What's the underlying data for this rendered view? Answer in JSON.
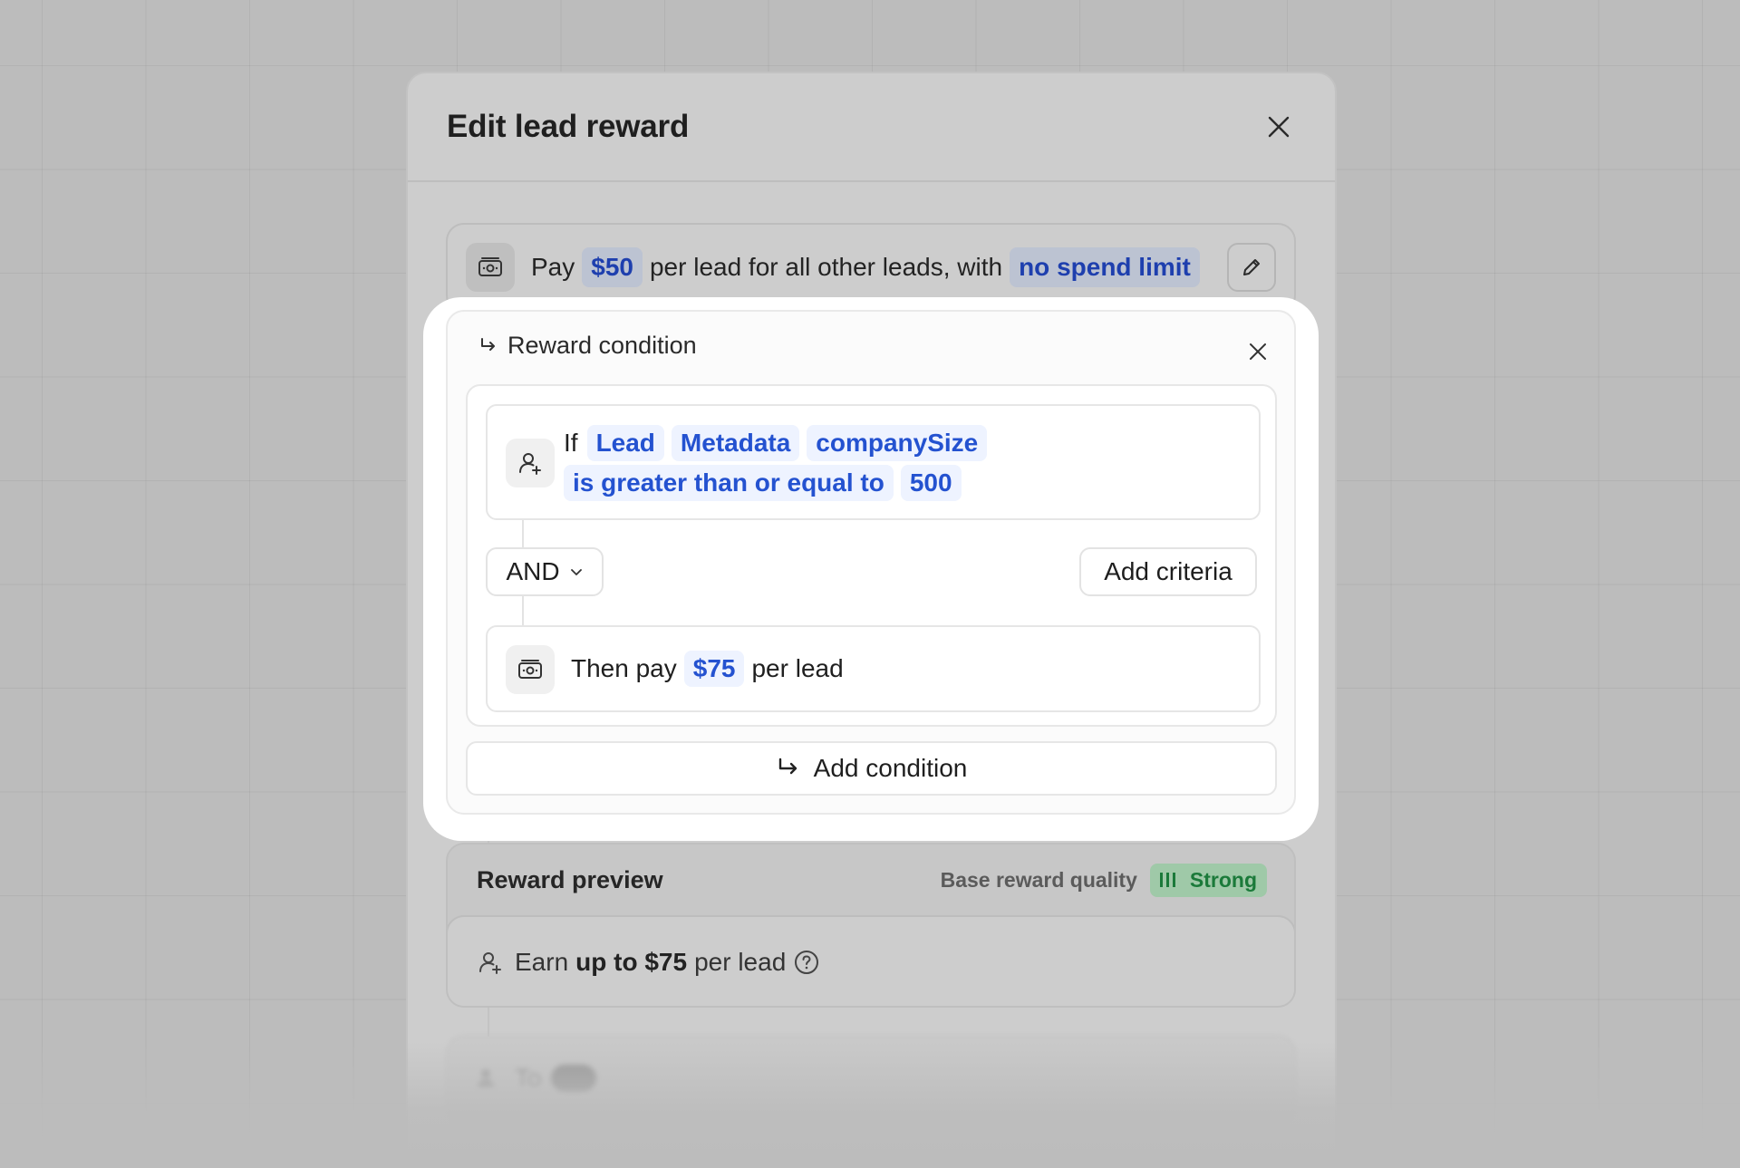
{
  "modal": {
    "title": "Edit lead reward"
  },
  "base_reward": {
    "pay_word": "Pay",
    "amount": "$50",
    "middle_text": "per lead for all other leads, with",
    "limit": "no spend limit"
  },
  "condition": {
    "title": "Reward condition",
    "if_word": "If",
    "entity": "Lead",
    "attribute": "Metadata",
    "field": "companySize",
    "operator": "is greater than or equal to",
    "value": "500",
    "logic": "AND",
    "add_criteria_label": "Add criteria",
    "then_text": "Then pay",
    "then_amount": "$75",
    "then_suffix": "per lead"
  },
  "add_condition_label": "Add condition",
  "preview": {
    "title": "Reward preview",
    "quality_label": "Base reward quality",
    "quality_value": "Strong",
    "earn_prefix": "Earn",
    "earn_bold": "up to $75",
    "earn_suffix": "per lead"
  },
  "blurred_row": {
    "text": "To"
  },
  "colors": {
    "chip_bg": "#eef3ff",
    "chip_text": "#2452d0",
    "badge_bg": "#9fc9a8",
    "badge_text": "#1b7a3a"
  }
}
